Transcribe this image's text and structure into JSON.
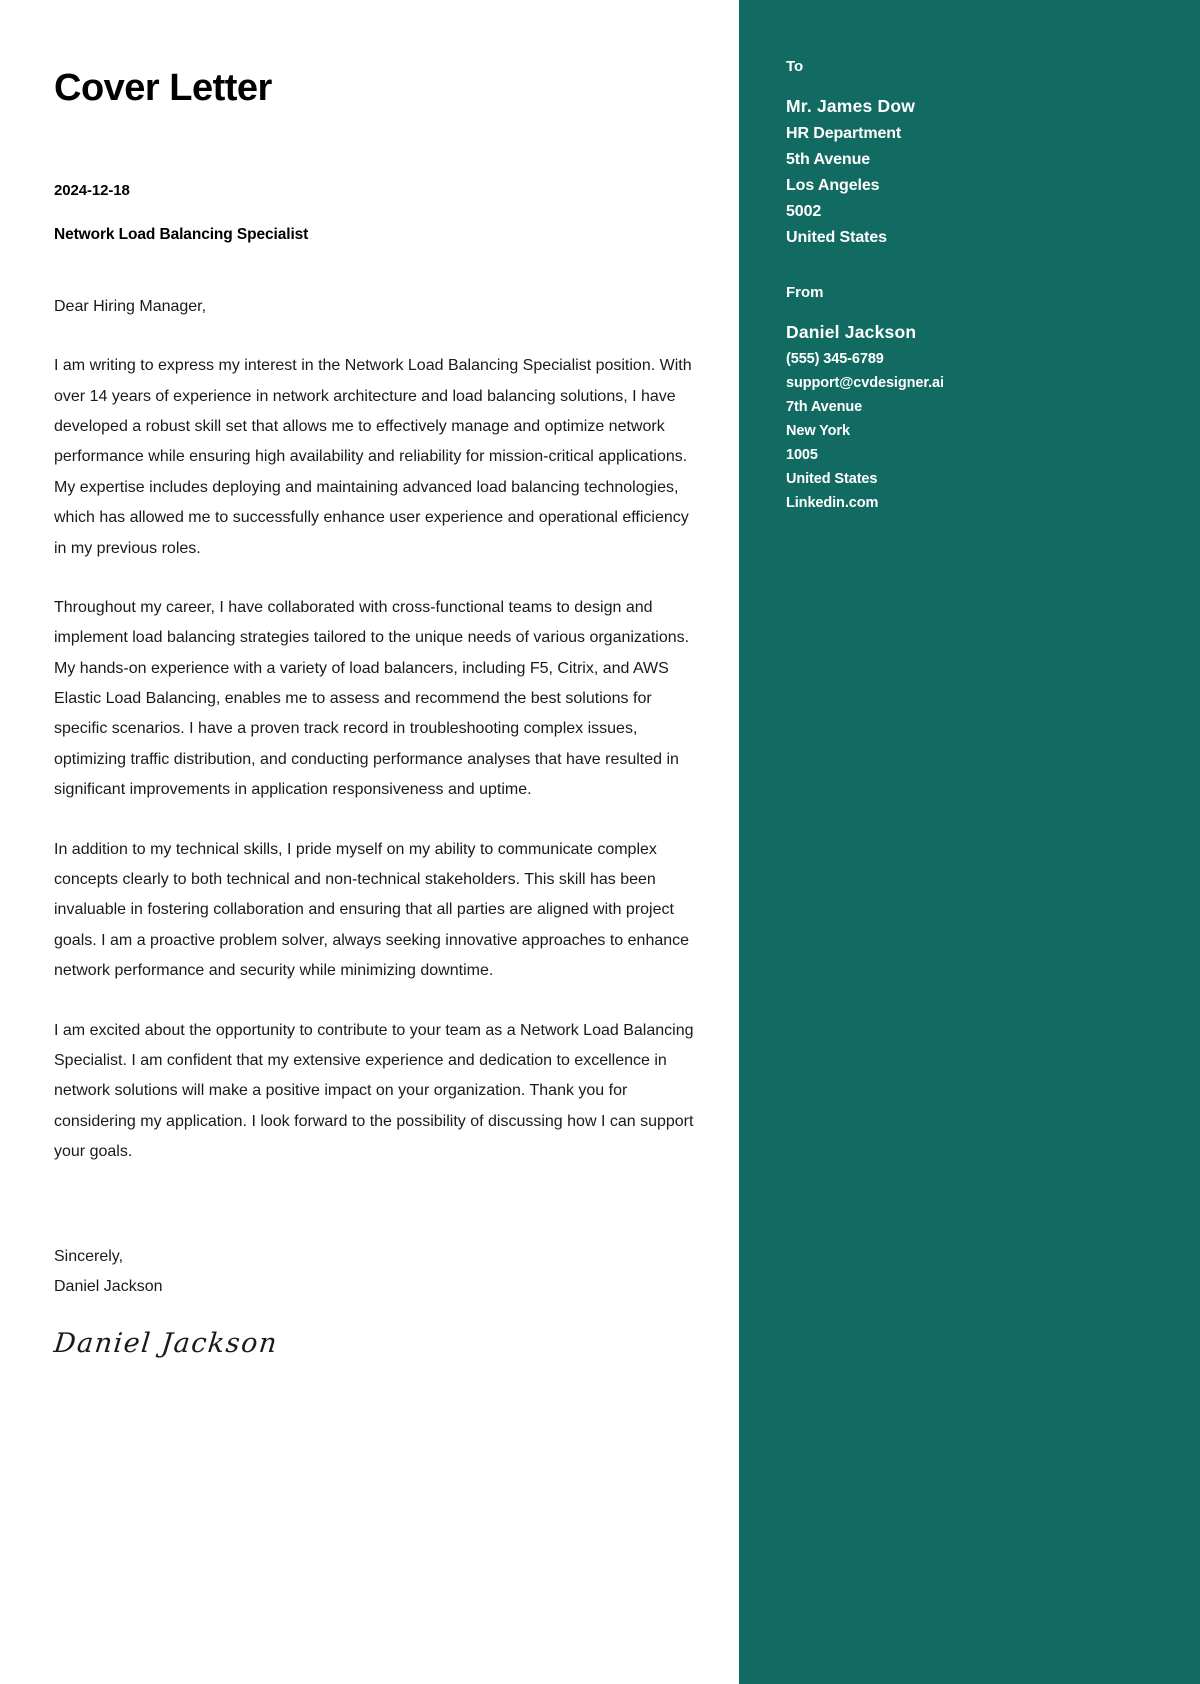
{
  "document": {
    "title": "Cover Letter",
    "date": "2024-12-18",
    "position": "Network Load Balancing Specialist",
    "salutation": "Dear Hiring Manager,",
    "paragraphs": [
      "I am writing to express my interest in the Network Load Balancing Specialist position. With over 14 years of experience in network architecture and load balancing solutions, I have developed a robust skill set that allows me to effectively manage and optimize network performance while ensuring high availability and reliability for mission-critical applications. My expertise includes deploying and maintaining advanced load balancing technologies, which has allowed me to successfully enhance user experience and operational efficiency in my previous roles.",
      "Throughout my career, I have collaborated with cross-functional teams to design and implement load balancing strategies tailored to the unique needs of various organizations. My hands-on experience with a variety of load balancers, including F5, Citrix, and AWS Elastic Load Balancing, enables me to assess and recommend the best solutions for specific scenarios. I have a proven track record in troubleshooting complex issues, optimizing traffic distribution, and conducting performance analyses that have resulted in significant improvements in application responsiveness and uptime.",
      "In addition to my technical skills, I pride myself on my ability to communicate complex concepts clearly to both technical and non-technical stakeholders. This skill has been invaluable in fostering collaboration and ensuring that all parties are aligned with project goals. I am a proactive problem solver, always seeking innovative approaches to enhance network performance and security while minimizing downtime.",
      "I am excited about the opportunity to contribute to your team as a Network Load Balancing Specialist. I am confident that my extensive experience and dedication to excellence in network solutions will make a positive impact on your organization. Thank you for considering my application. I look forward to the possibility of discussing how I can support your goals."
    ],
    "closing_word": "Sincerely,",
    "closing_name": "Daniel Jackson",
    "signature": "Daniel Jackson"
  },
  "sidebar": {
    "to": {
      "heading": "To",
      "name": "Mr. James Dow",
      "lines": [
        "HR Department",
        "5th Avenue",
        "Los Angeles",
        "5002",
        "United States"
      ]
    },
    "from": {
      "heading": "From",
      "name": "Daniel Jackson",
      "lines": [
        "(555) 345-6789",
        "support@cvdesigner.ai",
        "7th Avenue",
        "New York",
        "1005",
        "United States",
        "Linkedin.com"
      ]
    }
  },
  "theme": {
    "sidebar_bg": "#126b62",
    "page_bg": "#ffffff",
    "text_color": "#1a1a1a"
  }
}
